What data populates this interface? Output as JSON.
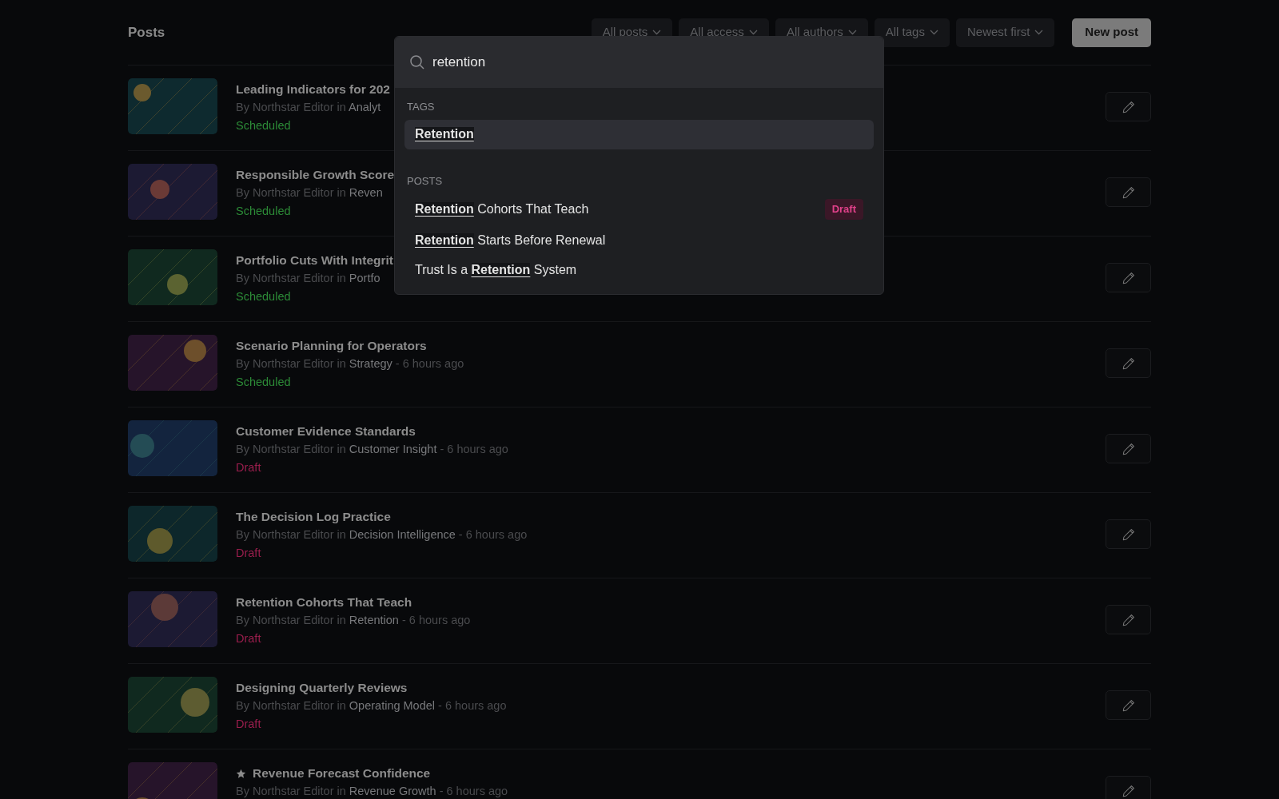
{
  "header": {
    "title": "Posts",
    "filters": [
      "All posts",
      "All access",
      "All authors",
      "All tags",
      "Newest first"
    ],
    "new_button": "New post"
  },
  "posts": [
    {
      "title": "Leading Indicators for 202",
      "author": "By Northstar Editor in",
      "category": "Analyt",
      "status": "Scheduled",
      "featured": false,
      "color": "#0e2a2f"
    },
    {
      "title": "Responsible Growth Score",
      "author": "By Northstar Editor in",
      "category": "Reven",
      "status": "Scheduled",
      "featured": false,
      "color": "#1c1a33"
    },
    {
      "title": "Portfolio Cuts With Integrit",
      "author": "By Northstar Editor in",
      "category": "Portfo",
      "status": "Scheduled",
      "featured": false,
      "color": "#10291f"
    },
    {
      "title": "Scenario Planning for Operators",
      "author": "By Northstar Editor in",
      "category": "Strategy",
      "time": "- 6 hours ago",
      "status": "Scheduled",
      "featured": false,
      "color": "#26142a"
    },
    {
      "title": "Customer Evidence Standards",
      "author": "By Northstar Editor in",
      "category": "Customer Insight",
      "time": "- 6 hours ago",
      "status": "Draft",
      "featured": false,
      "color": "#13243e"
    },
    {
      "title": "The Decision Log Practice",
      "author": "By Northstar Editor in",
      "category": "Decision Intelligence",
      "time": "- 6 hours ago",
      "status": "Draft",
      "featured": false,
      "color": "#0d272b"
    },
    {
      "title": "Retention Cohorts That Teach",
      "author": "By Northstar Editor in",
      "category": "Retention",
      "time": "- 6 hours ago",
      "status": "Draft",
      "featured": false,
      "color": "#1c1a33"
    },
    {
      "title": "Designing Quarterly Reviews",
      "author": "By Northstar Editor in",
      "category": "Operating Model",
      "time": "- 6 hours ago",
      "status": "Draft",
      "featured": false,
      "color": "#10291f"
    },
    {
      "title": "Revenue Forecast Confidence",
      "author": "By Northstar Editor in",
      "category": "Revenue Growth",
      "time": "- 6 hours ago",
      "featured": true,
      "color": "#26142a"
    }
  ],
  "search": {
    "value": "retention",
    "tags_label": "TAGS",
    "tags": [
      {
        "parts": [
          {
            "text": "Retention",
            "match": true
          }
        ],
        "selected": true
      }
    ],
    "posts_label": "POSTS",
    "results": [
      {
        "parts": [
          {
            "text": "Retention",
            "match": true
          },
          {
            "text": " Cohorts That Teach",
            "match": false
          }
        ],
        "badge": "Draft",
        "selected": false
      },
      {
        "parts": [
          {
            "text": "Retention",
            "match": true
          },
          {
            "text": " Starts Before Renewal",
            "match": false
          }
        ],
        "selected": false
      },
      {
        "parts": [
          {
            "text": "Trust Is a ",
            "match": false
          },
          {
            "text": "Retention",
            "match": true
          },
          {
            "text": " System",
            "match": false
          }
        ],
        "selected": false
      }
    ]
  }
}
